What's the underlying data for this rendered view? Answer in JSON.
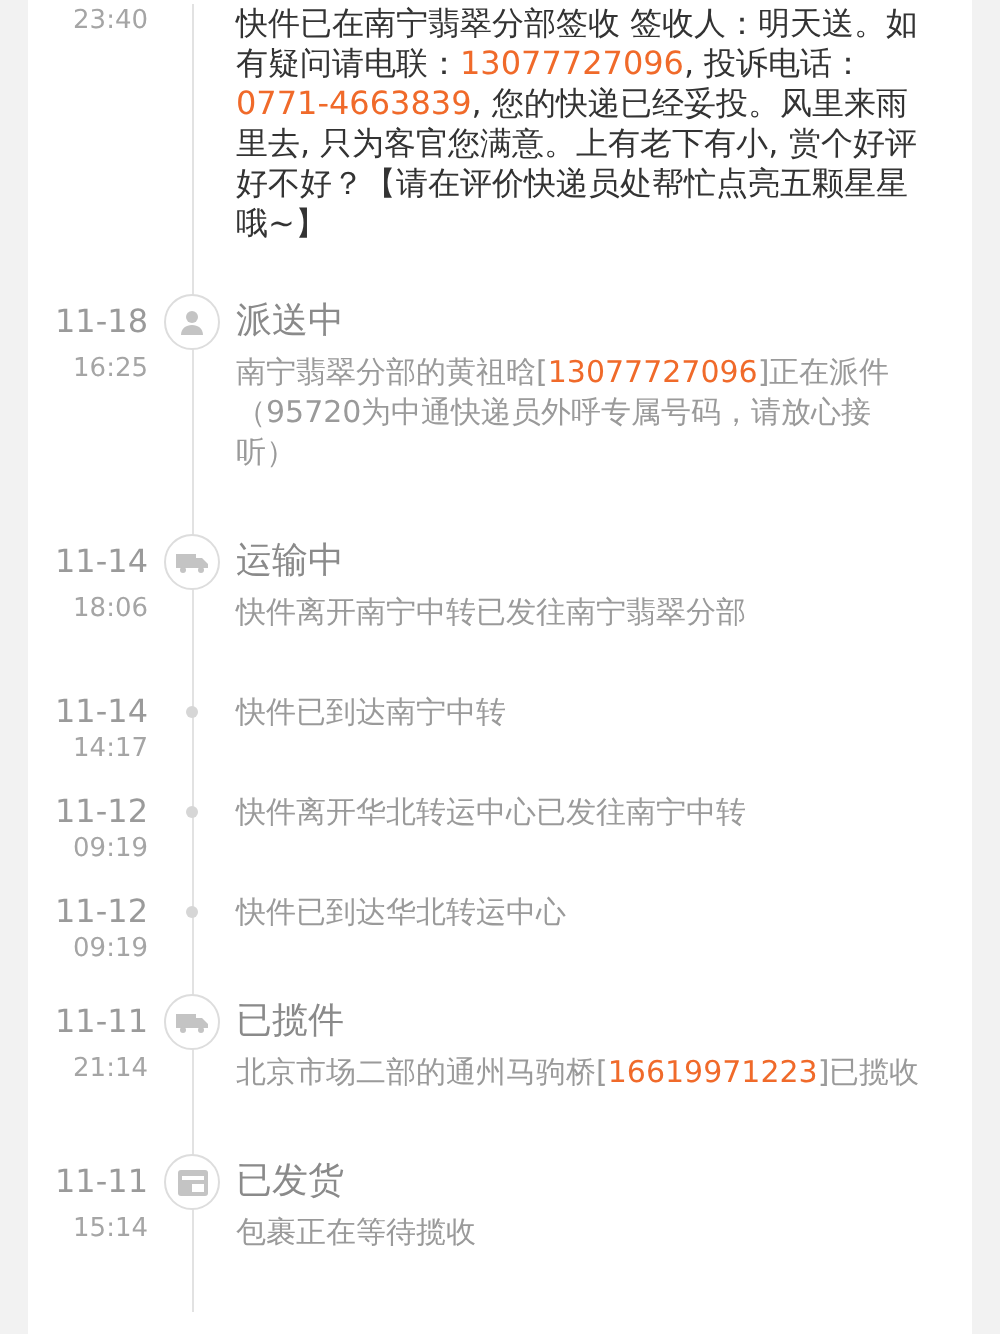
{
  "events": [
    {
      "kind": "step",
      "current": true,
      "time": "23:40",
      "desc": [
        {
          "kind": "plain",
          "text": "快件已在南宁翡翠分部签收 签收人：明天送。如有疑问请电联："
        },
        {
          "kind": "phone",
          "text": "13077727096"
        },
        {
          "kind": "plain",
          "text": ", 投诉电话："
        },
        {
          "kind": "phone",
          "text": "0771-4663839"
        },
        {
          "kind": "plain",
          "text": ", 您的快递已经妥投。风里来雨里去, 只为客官您满意。上有老下有小, 赏个好评好不好？【请在评价快递员处帮忙点亮五颗星星哦~】"
        }
      ]
    },
    {
      "kind": "status",
      "current": false,
      "date": "11-18",
      "time": "16:25",
      "title": "派送中",
      "desc": [
        {
          "kind": "plain",
          "text": "南宁翡翠分部的黄祖晗["
        },
        {
          "kind": "phone",
          "text": "13077727096"
        },
        {
          "kind": "plain",
          "text": "]正在派件（95720为中通快递员外呼专属号码，请放心接听）"
        }
      ]
    },
    {
      "kind": "status",
      "current": false,
      "date": "11-14",
      "time": "18:06",
      "title": "运输中",
      "desc": [
        {
          "kind": "plain",
          "text": "快件离开南宁中转已发往南宁翡翠分部"
        }
      ]
    },
    {
      "kind": "step",
      "current": false,
      "date": "11-14",
      "time": "14:17",
      "desc": [
        {
          "kind": "plain",
          "text": "快件已到达南宁中转"
        }
      ]
    },
    {
      "kind": "step",
      "current": false,
      "date": "11-12",
      "time": "09:19",
      "desc": [
        {
          "kind": "plain",
          "text": "快件离开华北转运中心已发往南宁中转"
        }
      ]
    },
    {
      "kind": "step",
      "current": false,
      "date": "11-12",
      "time": "09:19",
      "desc": [
        {
          "kind": "plain",
          "text": "快件已到达华北转运中心"
        }
      ]
    },
    {
      "kind": "status",
      "current": false,
      "date": "11-11",
      "time": "21:14",
      "title": "已揽件",
      "desc": [
        {
          "kind": "plain",
          "text": "北京市场二部的通州马驹桥["
        },
        {
          "kind": "phone",
          "text": "16619971223"
        },
        {
          "kind": "plain",
          "text": "]已揽收"
        }
      ]
    },
    {
      "kind": "status",
      "current": false,
      "date": "11-11",
      "time": "15:14",
      "title": "已发货",
      "desc": [
        {
          "kind": "plain",
          "text": "包裹正在等待揽收"
        }
      ]
    }
  ]
}
